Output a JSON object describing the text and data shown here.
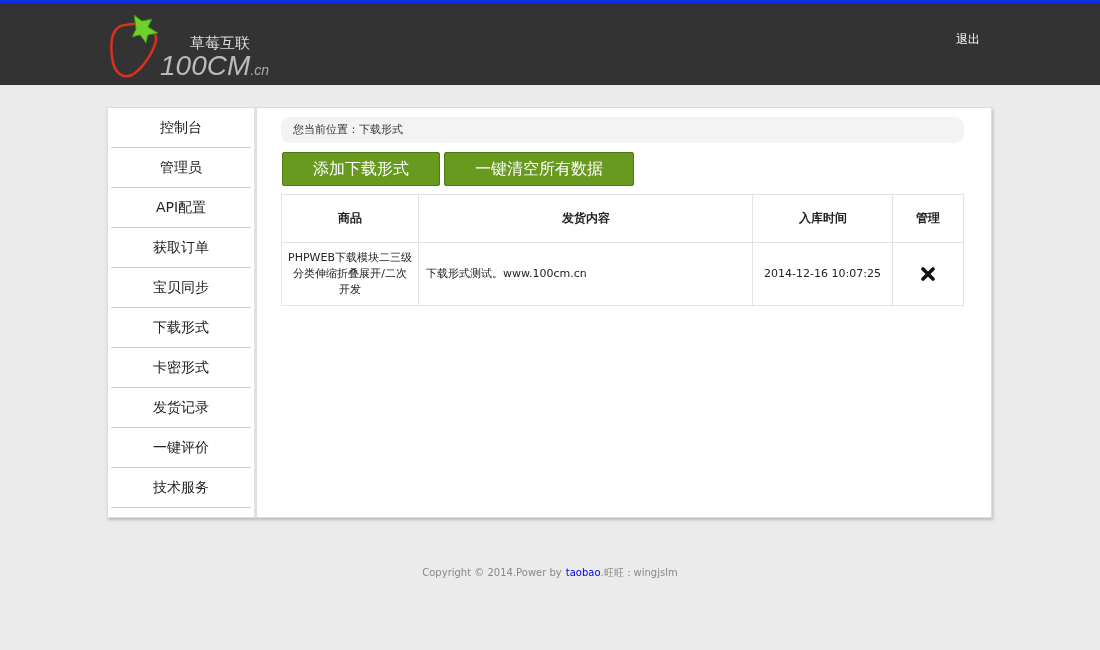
{
  "header": {
    "logo": {
      "tagline": "草莓互联",
      "brand": "100CM",
      "suffix": ".cn"
    },
    "logout": "退出"
  },
  "sidebar": {
    "items": [
      {
        "label": "控制台"
      },
      {
        "label": "管理员"
      },
      {
        "label": "API配置"
      },
      {
        "label": "获取订单"
      },
      {
        "label": "宝贝同步"
      },
      {
        "label": "下载形式"
      },
      {
        "label": "卡密形式"
      },
      {
        "label": "发货记录"
      },
      {
        "label": "一键评价"
      },
      {
        "label": "技术服务"
      }
    ]
  },
  "breadcrumb": "您当前位置：下载形式",
  "buttons": [
    "添加下载形式",
    "一键清空所有数据"
  ],
  "table": {
    "columns": [
      "商品",
      "发货内容",
      "入库时间",
      "管理"
    ],
    "rows": [
      {
        "product": "PHPWEB下载模块二三级分类伸缩折叠展开/二次开发",
        "content": "下载形式测试。www.100cm.cn",
        "time": "2014-12-16 10:07:25"
      }
    ]
  },
  "footer": {
    "text": "Copyright © 2014.Power by",
    "link": "taobao",
    "contact": ".旺旺：wingjslm"
  }
}
